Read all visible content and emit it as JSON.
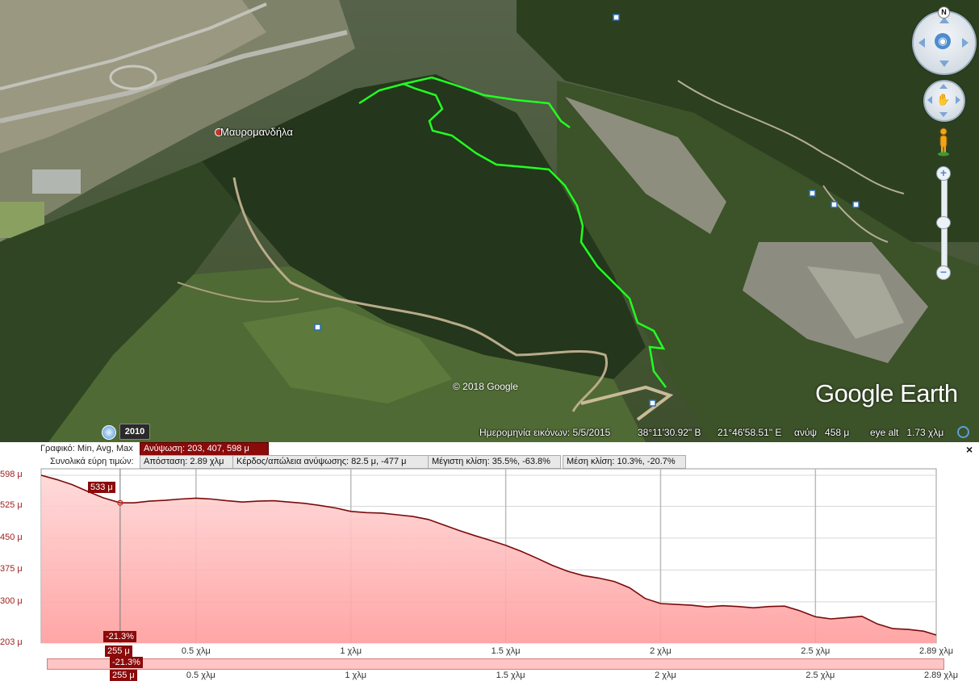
{
  "map": {
    "place_name": "Μαυρομανδήλα",
    "copyright": "© 2018 Google",
    "logo": "Google Earth",
    "history_year": "2010",
    "compass_letter": "N",
    "status": {
      "imagery_date": "Ημερομηνία εικόνων: 5/5/2015",
      "latitude": "38°11'30.92\" Β",
      "longitude": "21°46'58.51\" Ε",
      "elevation": "ανύψ   458 μ",
      "eye_alt": "eye alt   1.73 χλμ"
    },
    "colors": {
      "track": "#22ff22",
      "accent": "#4d8ccf"
    }
  },
  "profile": {
    "row1": {
      "label": "Γραφικό: Min, Avg, Max",
      "elevation_box": "Ανύψωση: 203, 407, 598 μ"
    },
    "row2": {
      "label": "Συνολικά εύρη τιμών:",
      "distance_box": "Απόσταση: 2.89 χλμ",
      "gain_box": "Κέρδος/απώλεια ανύψωσης: 82.5 μ, -477 μ",
      "max_slope_box": "Μέγιστη κλίση: 35.5%, -63.8%",
      "avg_slope_box": "Μέση κλίση: 10.3%, -20.7%"
    },
    "cursor": {
      "elevation_tag": "533 μ",
      "slope_tag": "-21.3%",
      "distance_tag": "255 μ",
      "slope_tag_2": "-21.3%",
      "distance_tag_2": "255 μ"
    },
    "colors": {
      "fill": "#ffd0d0",
      "line": "#7a0a0a",
      "box": "#8b0a0a"
    }
  },
  "chart_data": {
    "type": "area",
    "xlabel": "",
    "ylabel": "",
    "xlim": [
      0,
      2.89
    ],
    "ylim": [
      203,
      598
    ],
    "y_tick_labels": [
      "598 μ",
      "525 μ",
      "450 μ",
      "375 μ",
      "300 μ",
      "203 μ"
    ],
    "y_tick_values": [
      598,
      525,
      450,
      375,
      300,
      203
    ],
    "x_tick_labels": [
      "0.5 χλμ",
      "1 χλμ",
      "1.5 χλμ",
      "2 χλμ",
      "2.5 χλμ",
      "2.89 χλμ"
    ],
    "x_tick_values": [
      0.5,
      1,
      1.5,
      2,
      2.5,
      2.89
    ],
    "grid": true,
    "series": [
      {
        "x": [
          0,
          0.05,
          0.1,
          0.15,
          0.2,
          0.255,
          0.3,
          0.35,
          0.4,
          0.45,
          0.5,
          0.55,
          0.6,
          0.65,
          0.7,
          0.75,
          0.8,
          0.85,
          0.9,
          0.95,
          1.0,
          1.05,
          1.1,
          1.15,
          1.2,
          1.25,
          1.3,
          1.35,
          1.4,
          1.45,
          1.5,
          1.55,
          1.6,
          1.65,
          1.7,
          1.75,
          1.8,
          1.85,
          1.9,
          1.95,
          2.0,
          2.05,
          2.1,
          2.15,
          2.2,
          2.25,
          2.3,
          2.35,
          2.4,
          2.45,
          2.5,
          2.55,
          2.6,
          2.65,
          2.7,
          2.75,
          2.8,
          2.85,
          2.89
        ],
        "y": [
          598,
          588,
          576,
          560,
          545,
          533,
          533,
          537,
          539,
          542,
          544,
          542,
          538,
          535,
          537,
          538,
          535,
          532,
          527,
          521,
          513,
          510,
          509,
          505,
          501,
          494,
          481,
          468,
          456,
          445,
          433,
          419,
          403,
          386,
          372,
          362,
          356,
          348,
          333,
          308,
          296,
          294,
          292,
          288,
          291,
          289,
          286,
          289,
          290,
          279,
          265,
          260,
          263,
          266,
          248,
          237,
          235,
          231,
          222
        ]
      }
    ]
  }
}
